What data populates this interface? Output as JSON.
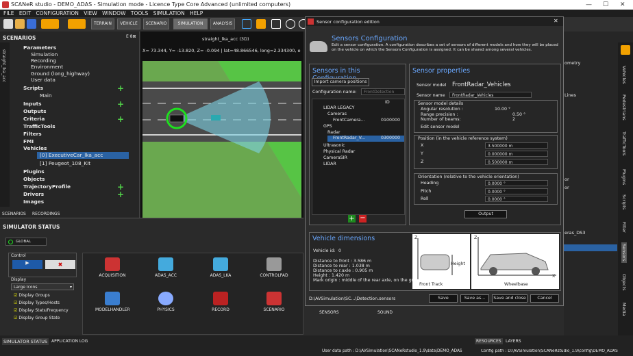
{
  "app": {
    "title": "SCANeR studio - DEMO_ADAS - Simulation mode - Licence Type Core Advanced (unlimited computers)"
  },
  "menu": [
    "FILE",
    "EDIT",
    "CONFIGURATION",
    "VIEW",
    "WINDOW",
    "TOOLS",
    "SIMULATION",
    "HELP"
  ],
  "toolbar": {
    "tabs": [
      "TERRAIN",
      "VEHICLE",
      "SCENARIO",
      "SIMULATION",
      "ANALYSIS"
    ]
  },
  "left": {
    "header": "SCENARIOS",
    "vtab": "straight_lka_acc",
    "tree": {
      "parameters": "Parameters",
      "simulation": "Simulation",
      "recording": "Recording",
      "environment": "Environment",
      "ground": "Ground (long_highway)",
      "userdata": "User data",
      "scripts": "Scripts",
      "main": "Main",
      "inputs": "Inputs",
      "outputs": "Outputs",
      "criteria": "Criteria",
      "traffictools": "TrafficTools",
      "filters": "Filters",
      "fmi": "FMI",
      "vehicles": "Vehicles",
      "veh0": "[0] ExecutiveCar_lka_acc",
      "veh1": "[1] Peugeot_108_Kit",
      "plugins": "Plugins",
      "objects": "Objects",
      "trajectory": "TrajectoryProfile",
      "drivers": "Drivers",
      "images": "Images"
    },
    "tabs": [
      "SCENARIOS",
      "RECORDINGS"
    ]
  },
  "viewport": {
    "title": "straight_lka_acc (3D)",
    "coords": "X= 73.344, Y= -13.820, Z= -0.094 | lat=48.866546, long=2.334300, e"
  },
  "status": {
    "header": "SIMULATOR STATUS",
    "global": "GLOBAL",
    "control": "Control",
    "display": "Display",
    "display_select": "Large Icons",
    "checks": [
      "Display Groups",
      "Display Types/Hosts",
      "Display Stats/Frequency",
      "Display Group State"
    ],
    "modules": [
      "ACQUISITION",
      "ADAS_ACC",
      "ADAS_LKA",
      "CONTROLPAD",
      "MODELHANDLER",
      "PHYSICS",
      "RECORD",
      "SCENARIO",
      "SENSORS",
      "SOUND"
    ]
  },
  "bottom": {
    "tabs": [
      "SIMULATOR STATUS",
      "APPLICATION LOG"
    ],
    "rtabs": [
      "RESOURCES",
      "LAYERS"
    ],
    "user_path": "User data path : D:\\AVSimulation\\SCANeRstudio_1.9\\data\\DEMO_ADAS",
    "config_path": "Config path : D:\\AVSimulation\\SCANeRstudio_1.9\\config\\DEMO_ADAS"
  },
  "dialog": {
    "title": "Sensor configuration edition",
    "heading": "Sensors Configuration",
    "desc": "Edit a sensor configuration. A configuration describes a set of sensors of different models and how they will be placed on the vehicle on which the Sensors Configuration is assigned. It can be shared among several vehicles.",
    "sic": {
      "title": "Sensors in this Configuration",
      "import": "Import camera positions",
      "cfg_label": "Configuration name:",
      "cfg_value": "FrontDetection",
      "col_id": "ID",
      "items": [
        "LIDAR LEGACY",
        "Cameras",
        "FrontCamera...",
        "GPS",
        "Radar",
        "FrontRadar_V...",
        "Ultrasonic",
        "Physical Radar",
        "CameraSIR",
        "LIDAR"
      ],
      "cam_id": "0100000",
      "radar_id": "0300000"
    },
    "sp": {
      "title": "Sensor properties",
      "model_label": "Sensor model",
      "model": "FrontRadar_Vehicles",
      "name_label": "Sensor name",
      "name": "FrontRadar_Vehicles",
      "details_label": "Sensor model details",
      "ang_label": "Angular resolution :",
      "ang": "10.00 °",
      "range_label": "Range precision :",
      "range": "0.50 °",
      "beams_label": "Number of beams:",
      "beams": "2",
      "edit": "Edit sensor model",
      "pos_label": "Position (in the vehicle reference system)",
      "x_label": "X",
      "x": "3.500000 m",
      "y_label": "Y",
      "y": "0.000000 m",
      "z_label": "Z",
      "z": "0.500000 m",
      "ori_label": "Orientation (relative to the vehicle orientation)",
      "heading_label": "Heading",
      "heading": "0.0000 °",
      "pitch_label": "Pitch",
      "pitch": "0.0000 °",
      "roll_label": "Roll",
      "roll": "0.0000 °",
      "output": "Output"
    },
    "vd": {
      "title": "Vehicle dimensions",
      "id_label": "Vehicle id:",
      "id": "0",
      "front": "Distance to front : 3.586 m",
      "rear": "Distance to rear : 1.038 m",
      "axle": "Distance to r.axle : 0.905 m",
      "height": "Height : 1.420 m",
      "mark": "Mark origin : middle of the rear axle, on the ground",
      "img1": [
        "Z",
        "Height",
        "Front Track"
      ],
      "img2": [
        "Z",
        "X",
        "Wheelbase"
      ]
    },
    "path": "D:\\AVSimulation\\SC...\\Detection.sensors",
    "buttons": [
      "Save",
      "Save as...",
      "Save and close",
      "Cancel"
    ]
  },
  "right": {
    "frag": [
      "ometry",
      "Lines",
      "or",
      "or",
      "eras_DS3"
    ],
    "vtabs": [
      "Vehicles",
      "Pedestrians",
      "TrafficTools",
      "Plugins",
      "Scripts",
      "Filter",
      "Sensors",
      "Objects",
      "Media"
    ]
  }
}
